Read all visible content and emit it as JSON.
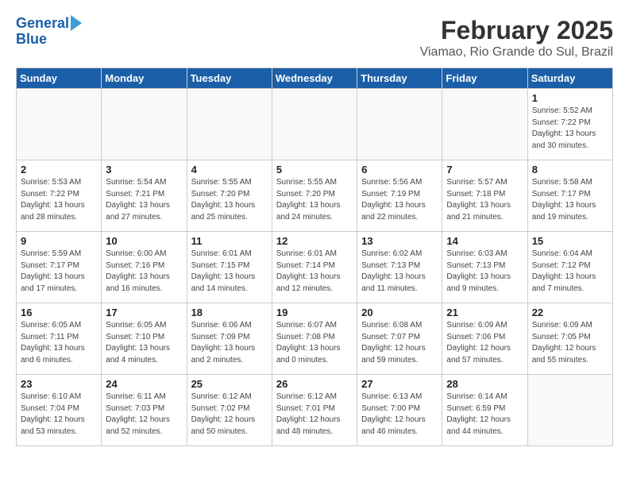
{
  "header": {
    "logo_line1": "General",
    "logo_line2": "Blue",
    "title": "February 2025",
    "subtitle": "Viamao, Rio Grande do Sul, Brazil"
  },
  "calendar": {
    "weekdays": [
      "Sunday",
      "Monday",
      "Tuesday",
      "Wednesday",
      "Thursday",
      "Friday",
      "Saturday"
    ],
    "weeks": [
      [
        {
          "day": "",
          "empty": true
        },
        {
          "day": "",
          "empty": true
        },
        {
          "day": "",
          "empty": true
        },
        {
          "day": "",
          "empty": true
        },
        {
          "day": "",
          "empty": true
        },
        {
          "day": "",
          "empty": true
        },
        {
          "day": "1",
          "info": "Sunrise: 5:52 AM\nSunset: 7:22 PM\nDaylight: 13 hours\nand 30 minutes."
        }
      ],
      [
        {
          "day": "2",
          "info": "Sunrise: 5:53 AM\nSunset: 7:22 PM\nDaylight: 13 hours\nand 28 minutes."
        },
        {
          "day": "3",
          "info": "Sunrise: 5:54 AM\nSunset: 7:21 PM\nDaylight: 13 hours\nand 27 minutes."
        },
        {
          "day": "4",
          "info": "Sunrise: 5:55 AM\nSunset: 7:20 PM\nDaylight: 13 hours\nand 25 minutes."
        },
        {
          "day": "5",
          "info": "Sunrise: 5:55 AM\nSunset: 7:20 PM\nDaylight: 13 hours\nand 24 minutes."
        },
        {
          "day": "6",
          "info": "Sunrise: 5:56 AM\nSunset: 7:19 PM\nDaylight: 13 hours\nand 22 minutes."
        },
        {
          "day": "7",
          "info": "Sunrise: 5:57 AM\nSunset: 7:18 PM\nDaylight: 13 hours\nand 21 minutes."
        },
        {
          "day": "8",
          "info": "Sunrise: 5:58 AM\nSunset: 7:17 PM\nDaylight: 13 hours\nand 19 minutes."
        }
      ],
      [
        {
          "day": "9",
          "info": "Sunrise: 5:59 AM\nSunset: 7:17 PM\nDaylight: 13 hours\nand 17 minutes."
        },
        {
          "day": "10",
          "info": "Sunrise: 6:00 AM\nSunset: 7:16 PM\nDaylight: 13 hours\nand 16 minutes."
        },
        {
          "day": "11",
          "info": "Sunrise: 6:01 AM\nSunset: 7:15 PM\nDaylight: 13 hours\nand 14 minutes."
        },
        {
          "day": "12",
          "info": "Sunrise: 6:01 AM\nSunset: 7:14 PM\nDaylight: 13 hours\nand 12 minutes."
        },
        {
          "day": "13",
          "info": "Sunrise: 6:02 AM\nSunset: 7:13 PM\nDaylight: 13 hours\nand 11 minutes."
        },
        {
          "day": "14",
          "info": "Sunrise: 6:03 AM\nSunset: 7:13 PM\nDaylight: 13 hours\nand 9 minutes."
        },
        {
          "day": "15",
          "info": "Sunrise: 6:04 AM\nSunset: 7:12 PM\nDaylight: 13 hours\nand 7 minutes."
        }
      ],
      [
        {
          "day": "16",
          "info": "Sunrise: 6:05 AM\nSunset: 7:11 PM\nDaylight: 13 hours\nand 6 minutes."
        },
        {
          "day": "17",
          "info": "Sunrise: 6:05 AM\nSunset: 7:10 PM\nDaylight: 13 hours\nand 4 minutes."
        },
        {
          "day": "18",
          "info": "Sunrise: 6:06 AM\nSunset: 7:09 PM\nDaylight: 13 hours\nand 2 minutes."
        },
        {
          "day": "19",
          "info": "Sunrise: 6:07 AM\nSunset: 7:08 PM\nDaylight: 13 hours\nand 0 minutes."
        },
        {
          "day": "20",
          "info": "Sunrise: 6:08 AM\nSunset: 7:07 PM\nDaylight: 12 hours\nand 59 minutes."
        },
        {
          "day": "21",
          "info": "Sunrise: 6:09 AM\nSunset: 7:06 PM\nDaylight: 12 hours\nand 57 minutes."
        },
        {
          "day": "22",
          "info": "Sunrise: 6:09 AM\nSunset: 7:05 PM\nDaylight: 12 hours\nand 55 minutes."
        }
      ],
      [
        {
          "day": "23",
          "info": "Sunrise: 6:10 AM\nSunset: 7:04 PM\nDaylight: 12 hours\nand 53 minutes."
        },
        {
          "day": "24",
          "info": "Sunrise: 6:11 AM\nSunset: 7:03 PM\nDaylight: 12 hours\nand 52 minutes."
        },
        {
          "day": "25",
          "info": "Sunrise: 6:12 AM\nSunset: 7:02 PM\nDaylight: 12 hours\nand 50 minutes."
        },
        {
          "day": "26",
          "info": "Sunrise: 6:12 AM\nSunset: 7:01 PM\nDaylight: 12 hours\nand 48 minutes."
        },
        {
          "day": "27",
          "info": "Sunrise: 6:13 AM\nSunset: 7:00 PM\nDaylight: 12 hours\nand 46 minutes."
        },
        {
          "day": "28",
          "info": "Sunrise: 6:14 AM\nSunset: 6:59 PM\nDaylight: 12 hours\nand 44 minutes."
        },
        {
          "day": "",
          "empty": true
        }
      ]
    ]
  }
}
